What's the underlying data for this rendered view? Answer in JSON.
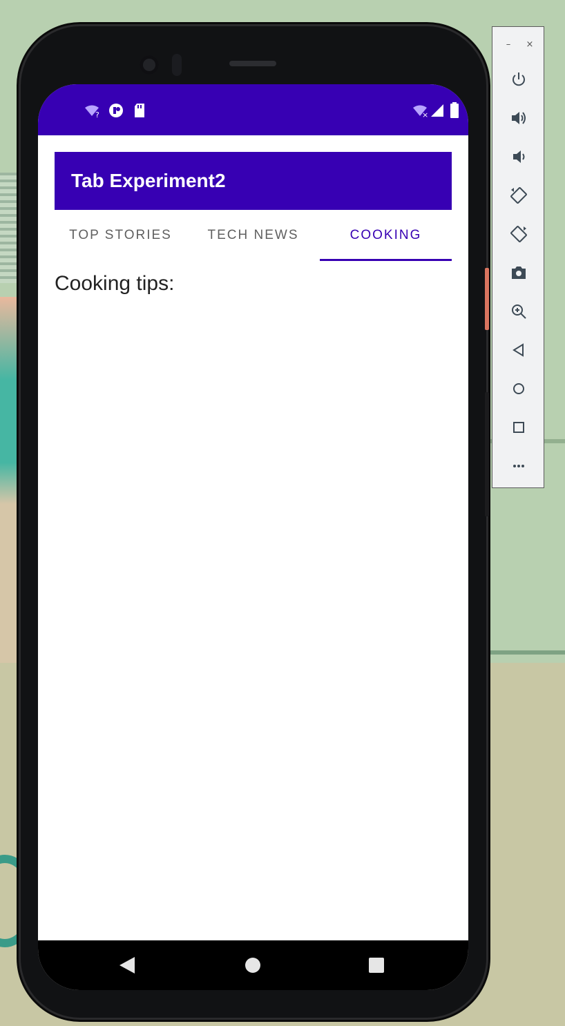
{
  "app": {
    "title": "Tab Experiment2"
  },
  "tabs": [
    {
      "label": "TOP STORIES",
      "active": false
    },
    {
      "label": "TECH NEWS",
      "active": false
    },
    {
      "label": "COOKING",
      "active": true
    }
  ],
  "content": {
    "text": "Cooking tips:"
  },
  "status_bar": {
    "left_icons": [
      "wifi-unknown-icon",
      "data-saver-icon",
      "sd-card-icon"
    ],
    "right_icons": [
      "wifi-off-icon",
      "cell-signal-icon",
      "battery-icon"
    ]
  },
  "nav_bar": {
    "buttons": [
      "back-icon",
      "home-icon",
      "recents-icon"
    ]
  },
  "emulator_toolbar": {
    "buttons": [
      "power-icon",
      "volume-up-icon",
      "volume-down-icon",
      "rotate-left-icon",
      "rotate-right-icon",
      "screenshot-icon",
      "zoom-icon",
      "back-icon",
      "home-icon",
      "overview-icon",
      "more-icon"
    ],
    "window_controls": [
      "minimize-icon",
      "close-icon"
    ]
  },
  "colors": {
    "primary": "#3700b3",
    "tab_inactive": "#5f5f5f",
    "screen_bg": "#ffffff"
  }
}
